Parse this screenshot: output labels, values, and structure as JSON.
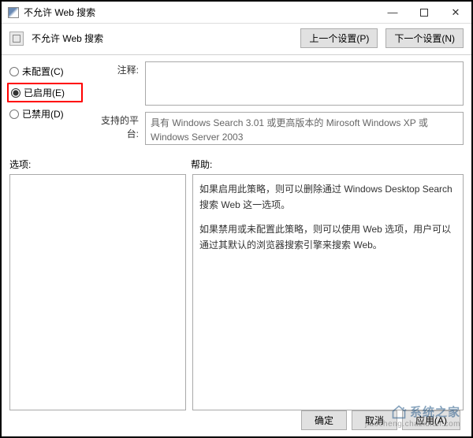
{
  "window": {
    "title": "不允许 Web 搜索",
    "minimize": "—",
    "close": "✕"
  },
  "header": {
    "title": "不允许 Web 搜索",
    "prev": "上一个设置(P)",
    "next": "下一个设置(N)"
  },
  "radios": {
    "not_configured": "未配置(C)",
    "enabled": "已启用(E)",
    "disabled": "已禁用(D)"
  },
  "fields": {
    "comment_label": "注释:",
    "platform_label": "支持的平台:",
    "platform_text": "具有 Windows Search 3.01 或更高版本的 Mirosoft Windows XP 或 Windows Server 2003"
  },
  "mid": {
    "options_label": "选项:",
    "help_label": "帮助:"
  },
  "help": {
    "p1": "如果启用此策略，则可以删除通过 Windows Desktop Search 搜索 Web 这一选项。",
    "p2": "如果禁用或未配置此策略，则可以使用 Web 选项，用户可以通过其默认的浏览器搜索引擎来搜索 Web。"
  },
  "footer": {
    "ok": "确定",
    "cancel": "取消",
    "apply": "应用(A)"
  },
  "watermark": {
    "brand": "系统之家",
    "sub": "jiaocheng.chazidian.com"
  }
}
